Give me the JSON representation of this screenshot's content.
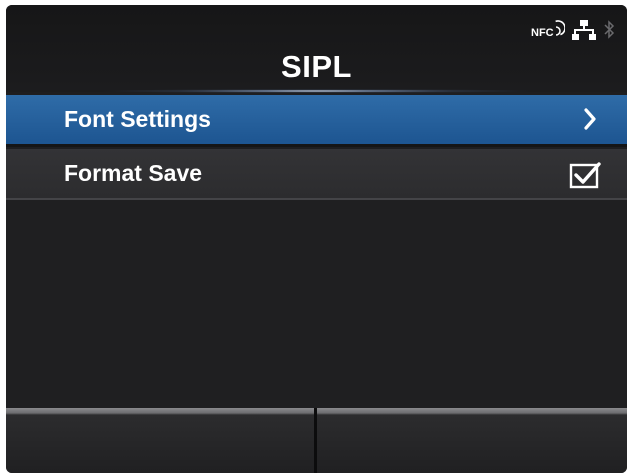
{
  "header": {
    "title": "SIPL",
    "status": {
      "nfc_label": "NFC",
      "icons": [
        "nfc-icon",
        "lan-icon",
        "bluetooth-icon"
      ]
    }
  },
  "menu": {
    "items": [
      {
        "label": "Font Settings",
        "indicator": "chevron-right-icon",
        "selected": true
      },
      {
        "label": "Format Save",
        "indicator": "checkbox-icon",
        "checked": true
      }
    ]
  },
  "softkeys": {
    "left": "",
    "right": ""
  },
  "colors": {
    "background": "#1e1e20",
    "selected_row": "#2a64a0",
    "text": "#ffffff"
  }
}
